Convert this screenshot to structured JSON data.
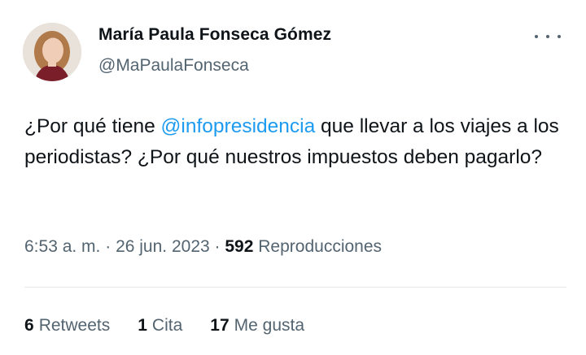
{
  "author": {
    "display_name": "María Paula Fonseca Gómez",
    "handle": "@MaPaulaFonseca",
    "avatar_icon": "profile-photo"
  },
  "tweet": {
    "text_before": "¿Por qué tiene ",
    "mention": "@infopresidencia",
    "text_after": " que llevar a los viajes a los periodistas? ¿Por qué nuestros impuestos deben pagarlo?"
  },
  "meta": {
    "time": "6:53 a. m.",
    "separator": "·",
    "date": "26 jun. 2023",
    "views_count": "592",
    "views_label": "Reproducciones"
  },
  "stats": [
    {
      "count": "6",
      "label": "Retweets"
    },
    {
      "count": "1",
      "label": "Cita"
    },
    {
      "count": "17",
      "label": "Me gusta"
    }
  ],
  "colors": {
    "link": "#1d9bf0",
    "secondary_text": "#536471",
    "primary_text": "#0f1419"
  }
}
